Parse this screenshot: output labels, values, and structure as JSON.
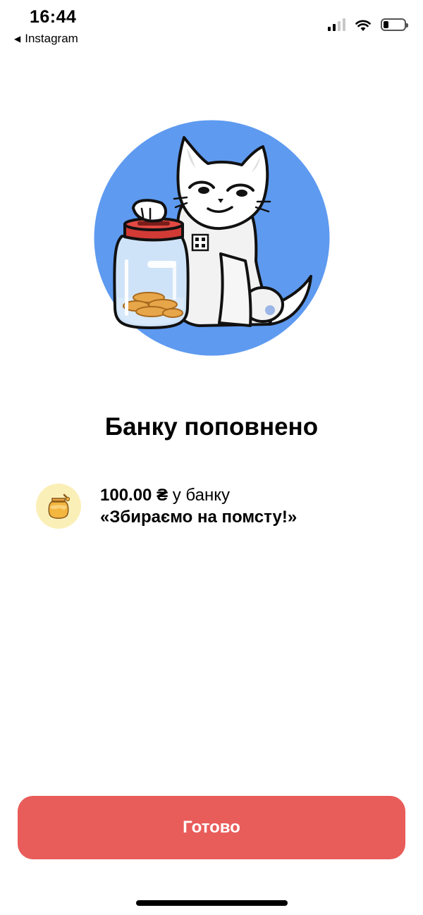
{
  "status_bar": {
    "time": "16:44",
    "back_app": "Instagram",
    "back_icon": "triangle-left-icon",
    "signal_icon": "cellular-signal-icon",
    "wifi_icon": "wifi-icon",
    "battery_icon": "battery-icon",
    "battery_level": 0.25
  },
  "illustration": {
    "name": "cat-with-coin-jar",
    "circle_color": "#5e9af0"
  },
  "main": {
    "title": "Банку поповнено",
    "amount": "100.00 ₴",
    "amount_suffix": " у банку",
    "jar_name": "«Збираємо на помсту!»",
    "jar_icon": "honey-jar-icon",
    "badge_color": "#fbefb8"
  },
  "footer": {
    "done_label": "Готово",
    "button_color": "#e85c5a"
  }
}
